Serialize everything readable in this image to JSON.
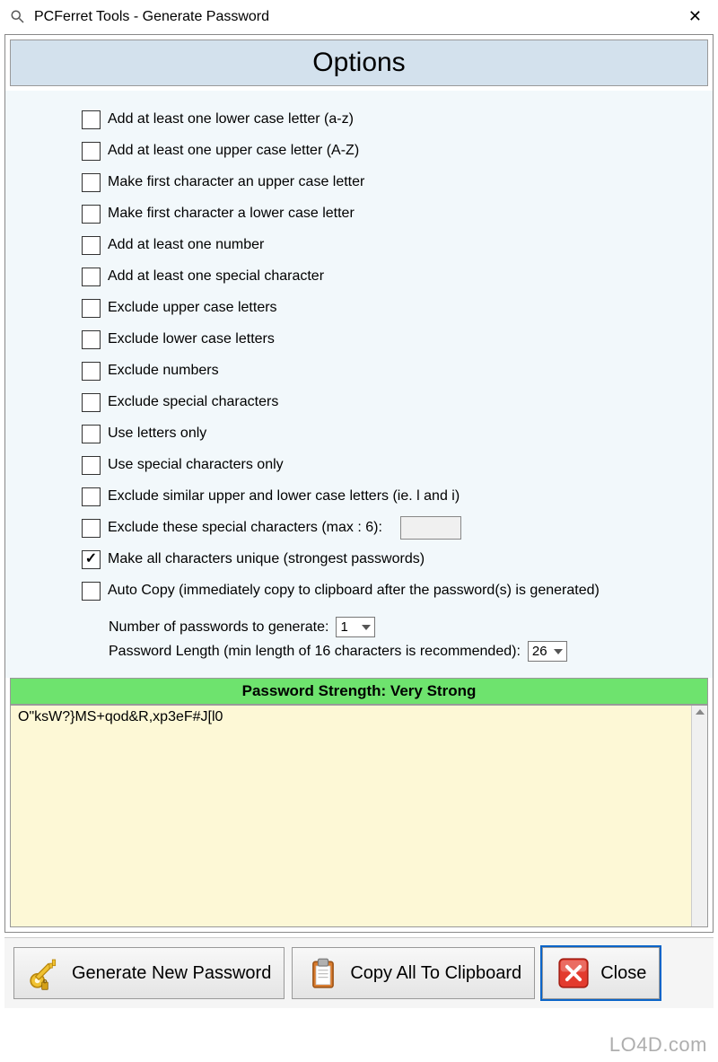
{
  "titlebar": {
    "title": "PCFerret Tools - Generate Password"
  },
  "header": "Options",
  "options": [
    {
      "label": "Add at least one lower case letter (a-z)",
      "checked": false
    },
    {
      "label": "Add at least one upper case letter (A-Z)",
      "checked": false
    },
    {
      "label": "Make first character an upper case letter",
      "checked": false
    },
    {
      "label": "Make first character a lower case letter",
      "checked": false
    },
    {
      "label": "Add at least one number",
      "checked": false
    },
    {
      "label": "Add at least one special character",
      "checked": false
    },
    {
      "label": "Exclude upper case letters",
      "checked": false
    },
    {
      "label": "Exclude lower case letters",
      "checked": false
    },
    {
      "label": "Exclude numbers",
      "checked": false
    },
    {
      "label": "Exclude special characters",
      "checked": false
    },
    {
      "label": "Use letters only",
      "checked": false
    },
    {
      "label": "Use special characters only",
      "checked": false
    },
    {
      "label": "Exclude similar upper and lower case letters (ie. l and i)",
      "checked": false
    },
    {
      "label": "Exclude these special characters (max : 6):",
      "checked": false,
      "has_input": true,
      "input_value": ""
    },
    {
      "label": "Make all characters unique (strongest passwords)",
      "checked": true
    },
    {
      "label": "Auto Copy (immediately copy to clipboard after the password(s) is generated)",
      "checked": false
    }
  ],
  "numbers": {
    "passwords_label": "Number of passwords to generate:",
    "passwords_value": "1",
    "length_label": "Password Length (min length of 16 characters is recommended):",
    "length_value": "26"
  },
  "strength": "Password Strength: Very Strong",
  "result": "O\"ksW?}MS+qod&R,xp3eF#J[l0",
  "buttons": {
    "generate": "Generate New Password",
    "copy": "Copy All To Clipboard",
    "close": "Close"
  },
  "watermark": "LO4D.com"
}
